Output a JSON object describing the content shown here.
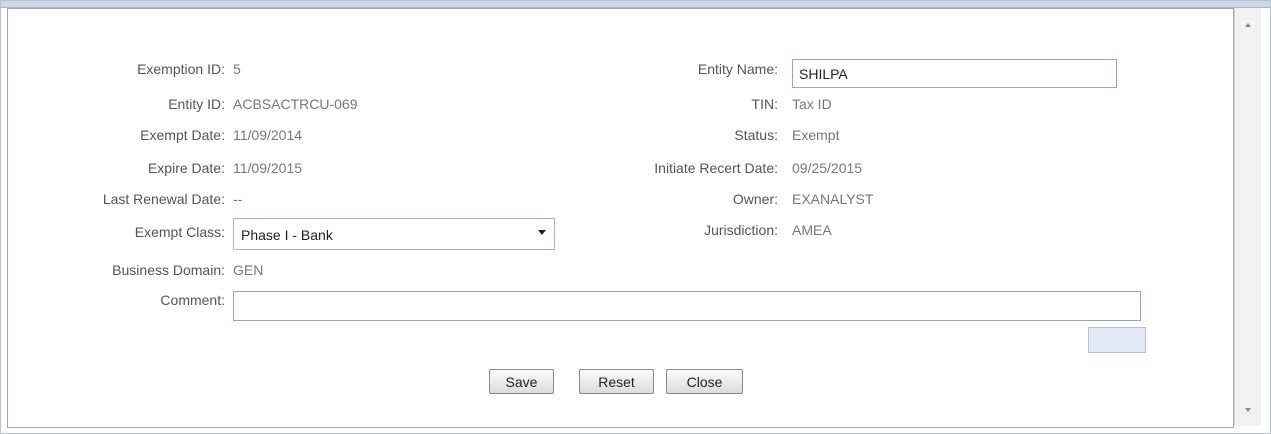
{
  "left": {
    "exemption_id": {
      "label": "Exemption ID:",
      "value": "5"
    },
    "entity_id": {
      "label": "Entity ID:",
      "value": "ACBSACTRCU-069"
    },
    "exempt_date": {
      "label": "Exempt Date:",
      "value": "11/09/2014"
    },
    "expire_date": {
      "label": "Expire Date:",
      "value": "11/09/2015"
    },
    "last_renewal_date": {
      "label": "Last Renewal Date:",
      "value": "--"
    },
    "exempt_class": {
      "label": "Exempt Class:",
      "selected": "Phase I - Bank"
    },
    "business_domain": {
      "label": "Business Domain:",
      "value": "GEN"
    },
    "comment": {
      "label": "Comment:",
      "value": ""
    }
  },
  "right": {
    "entity_name": {
      "label": "Entity Name:",
      "value": "SHILPA"
    },
    "tin": {
      "label": "TIN:",
      "value": "Tax ID"
    },
    "status": {
      "label": "Status:",
      "value": "Exempt"
    },
    "initiate_recert_date": {
      "label": "Initiate Recert Date:",
      "value": "09/25/2015"
    },
    "owner": {
      "label": "Owner:",
      "value": "EXANALYST"
    },
    "jurisdiction": {
      "label": "Jurisdiction:",
      "value": "AMEA"
    }
  },
  "buttons": {
    "save": "Save",
    "reset": "Reset",
    "close": "Close"
  },
  "icons": {
    "scroll_up": "chevron-up-icon",
    "scroll_down": "chevron-down-icon",
    "dropdown": "dropdown-arrow-icon"
  }
}
